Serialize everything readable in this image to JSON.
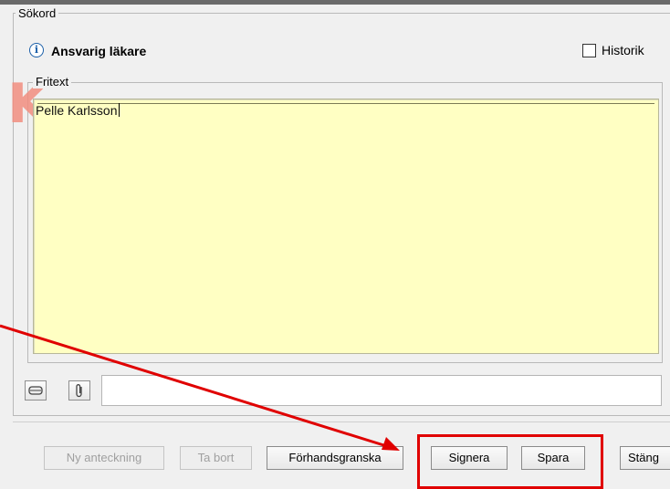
{
  "sokord": {
    "legend": "Sökord"
  },
  "header": {
    "title": "Ansvarig läkare",
    "historik_label": "Historik",
    "historik_checked": false
  },
  "fritext": {
    "legend": "Fritext",
    "content": "Pelle Karlsson"
  },
  "toolbar": {
    "icons": [
      "eraser-icon",
      "paperclip-icon"
    ]
  },
  "buttons": {
    "ny_anteckning": "Ny anteckning",
    "ta_bort": "Ta bort",
    "forhandsgranska": "Förhandsgranska",
    "signera": "Signera",
    "spara": "Spara",
    "stang": "Stäng"
  },
  "annotation": {
    "color": "#e00000"
  }
}
